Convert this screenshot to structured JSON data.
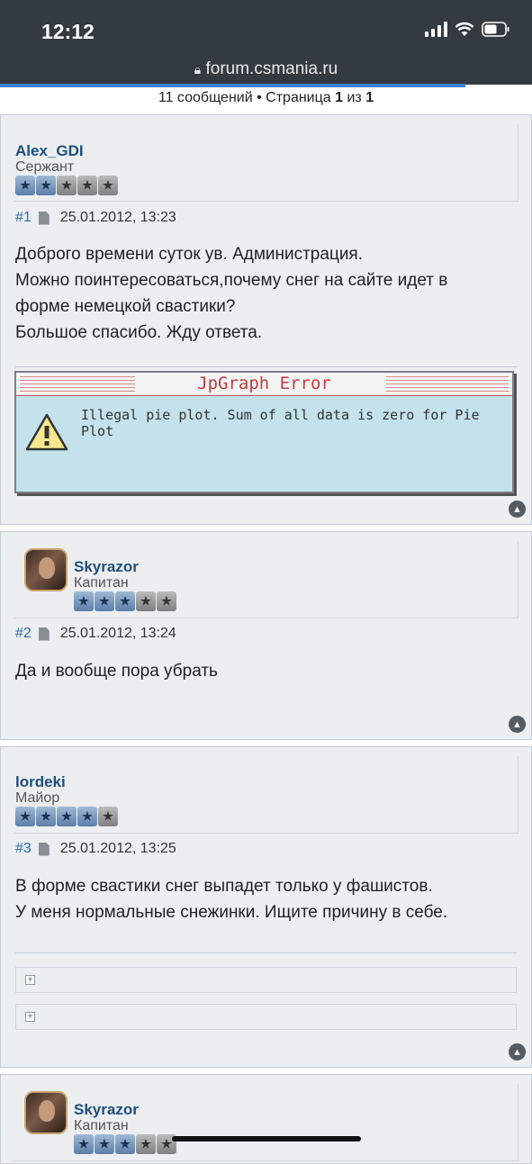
{
  "status_bar": {
    "time": "12:12"
  },
  "browser": {
    "url": "forum.csmania.ru"
  },
  "pagination": {
    "prefix": "11 сообщений • Страница ",
    "current": "1",
    "middle": " из ",
    "total": "1"
  },
  "posts": [
    {
      "username": "Alex_GDI",
      "rank": "Сержант",
      "stars_filled": 2,
      "stars_total": 5,
      "num": "#1",
      "date": "25.01.2012, 13:23",
      "lines": [
        "Доброго времени суток ув. Администрация.",
        "Можно поинтересоваться,почему снег на сайте идет в",
        "форме немецкой свастики?",
        "Большое спасибо. Жду ответа."
      ],
      "jpgraph": {
        "title": "JpGraph Error",
        "message": "Illegal pie plot. Sum of all data is zero for Pie Plot"
      }
    },
    {
      "username": "Skyrazor",
      "rank": "Капитан",
      "stars_filled": 3,
      "stars_total": 5,
      "num": "#2",
      "date": "25.01.2012, 13:24",
      "lines": [
        "Да и вообще пора убрать"
      ]
    },
    {
      "username": "lordeki",
      "rank": "Майор",
      "stars_filled": 4,
      "stars_total": 5,
      "num": "#3",
      "date": "25.01.2012, 13:25",
      "lines": [
        "В форме свастики снег выпадет только у фашистов.",
        "У меня нормальные снежинки. Ищите причину в себе."
      ]
    },
    {
      "username": "Skyrazor",
      "rank": "Капитан",
      "stars_filled": 3,
      "stars_total": 5
    }
  ],
  "colors": {
    "username": "#1e4f7d",
    "post_bg": "#eceef0",
    "status_bar": "#333a40",
    "accent": "#3a7fd5"
  }
}
